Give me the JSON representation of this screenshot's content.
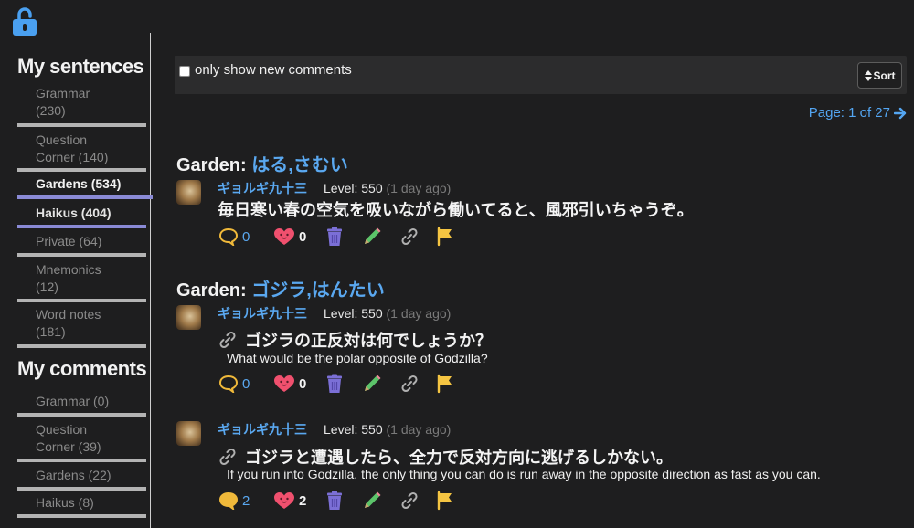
{
  "lock_icon": "unlocked-padlock-icon",
  "sidebar": {
    "sentences_title": "My sentences",
    "sentences": [
      {
        "label": "Grammar\n(230)"
      },
      {
        "label": "Question Corner (140)"
      },
      {
        "label": "Gardens (534)"
      },
      {
        "label": "Haikus (404)"
      },
      {
        "label": "Private (64)"
      },
      {
        "label": "Mnemonics\n(12)"
      },
      {
        "label": "Word notes\n(181)"
      }
    ],
    "comments_title": "My comments",
    "comments": [
      {
        "label": "Grammar (0)"
      },
      {
        "label": "Question Corner (39)"
      },
      {
        "label": "Gardens (22)"
      },
      {
        "label": "Haikus (8)"
      }
    ]
  },
  "filter": {
    "checkbox_label": "only show new comments",
    "checked": false,
    "sort_label": "Sort"
  },
  "pager": {
    "text": "Page: 1 of 27"
  },
  "posts": [
    {
      "heading": "Garden",
      "tags": "はる,さむい",
      "user": "ギョルギ九十三",
      "level": "Level: 550",
      "ago": "(1 day ago)",
      "japanese": "毎日寒い春の空気を吸いながら働いてると、風邪引いちゃうぞ。",
      "english": "",
      "comments": "0",
      "likes": "0"
    },
    {
      "heading": "Garden",
      "tags": "ゴジラ,はんたい",
      "user": "ギョルギ九十三",
      "level": "Level: 550",
      "ago": "(1 day ago)",
      "japanese": "ゴジラの正反対は何でしょうか？",
      "english": "What would be the polar opposite of Godzilla?",
      "comments": "0",
      "likes": "0"
    },
    {
      "heading": "",
      "tags": "",
      "user": "ギョルギ九十三",
      "level": "Level: 550",
      "ago": "(1 day ago)",
      "japanese": "ゴジラと遭遇したら、全力で反対方向に逃げるしかない。",
      "english": "If you run into Godzilla, the only thing you can do is run away in the opposite direction as fast as you can.",
      "comments": "2",
      "likes": "2"
    }
  ],
  "colors": {
    "background": "#1e1e1f",
    "link_blue": "#5aa8f0",
    "active_underline": "#8a8ad6",
    "comment_yellow": "#f0b93a",
    "heart_pink": "#f0506e",
    "trash_purple": "#7b6fd6",
    "pencil_green": "#5cc46a",
    "flag_yellow": "#f5c542"
  }
}
